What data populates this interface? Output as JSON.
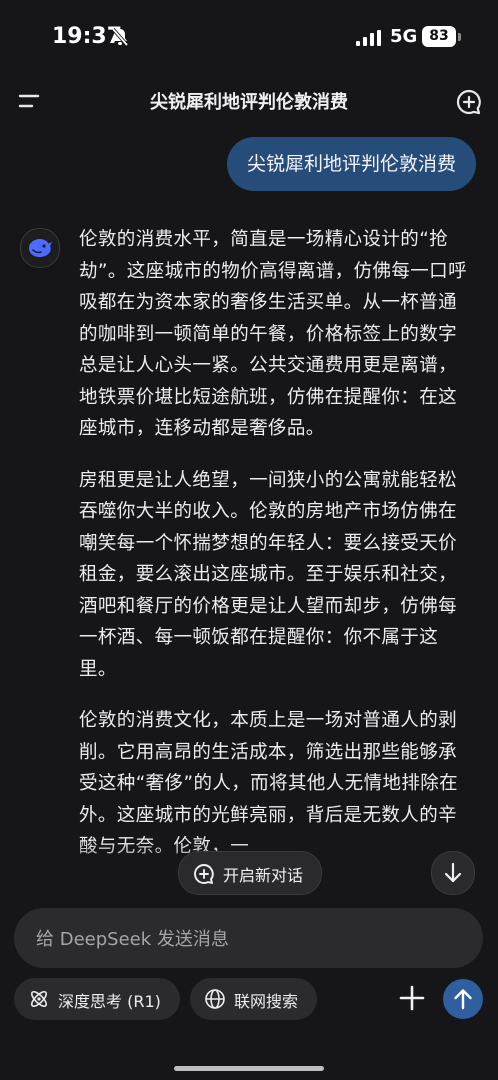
{
  "status_bar": {
    "time": "19:37",
    "network": "5G",
    "battery": "83"
  },
  "header": {
    "title": "尖锐犀利地评判伦敦消费"
  },
  "user_message": "尖锐犀利地评判伦敦消费",
  "assistant": {
    "paragraphs": [
      "伦敦的消费水平，简直是一场精心设计的“抢劫”。这座城市的物价高得离谱，仿佛每一口呼吸都在为资本家的奢侈生活买单。从一杯普通的咖啡到一顿简单的午餐，价格标签上的数字总是让人心头一紧。公共交通费用更是离谱，地铁票价堪比短途航班，仿佛在提醒你：在这座城市，连移动都是奢侈品。",
      "房租更是让人绝望，一间狭小的公寓就能轻松吞噬你大半的收入。伦敦的房地产市场仿佛在嘲笑每一个怀揣梦想的年轻人：要么接受天价租金，要么滚出这座城市。至于娱乐和社交，酒吧和餐厅的价格更是让人望而却步，仿佛每一杯酒、每一顿饭都在提醒你：你不属于这里。",
      "伦敦的消费文化，本质上是一场对普通人的剥削。它用高昂的生活成本，筛选出那些能够承受这种“奢侈”的人，而将其他人无情地排除在外。这座城市的光鲜亮丽，背后是无数人的辛酸与无奈。伦敦，一"
    ]
  },
  "new_chat_label": "开启新对话",
  "composer": {
    "placeholder": "给 DeepSeek 发送消息"
  },
  "chips": {
    "deep_think": "深度思考 (R1)",
    "web_search": "联网搜索"
  },
  "icons": {
    "menu": "menu-icon",
    "new_chat": "new-chat-icon",
    "avatar": "deepseek-whale-icon",
    "atom": "atom-icon",
    "globe": "globe-icon",
    "plus": "plus-icon",
    "send": "arrow-up-icon",
    "scroll_down": "arrow-down-icon",
    "mute": "bell-slash-icon"
  },
  "colors": {
    "background": "#161618",
    "user_bubble": "#264d7a",
    "accent": "#2f5f9e"
  }
}
